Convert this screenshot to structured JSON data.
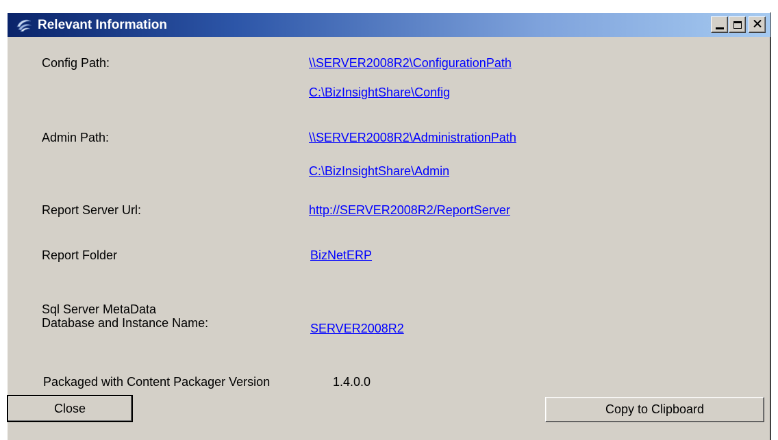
{
  "window": {
    "title": "Relevant Information",
    "icon": "app-swirl-icon",
    "controls": {
      "minimize": "minimize-icon",
      "maximize": "maximize-icon",
      "close": "close-icon"
    }
  },
  "fields": {
    "config_path": {
      "label": "Config Path:",
      "values": [
        "\\\\SERVER2008R2\\ConfigurationPath",
        "C:\\BizInsightShare\\Config"
      ]
    },
    "admin_path": {
      "label": "Admin Path:",
      "values": [
        "\\\\SERVER2008R2\\AdministrationPath",
        "C:\\BizInsightShare\\Admin"
      ]
    },
    "report_server_url": {
      "label": "Report Server Url:",
      "value": "http://SERVER2008R2/ReportServer"
    },
    "report_folder": {
      "label": "Report Folder",
      "value": "BizNetERP"
    },
    "sql_server": {
      "label_line1": "Sql Server MetaData",
      "label_line2": "Database and Instance Name:",
      "value": "SERVER2008R2"
    }
  },
  "version": {
    "label": "Packaged with Content Packager Version",
    "value": "1.4.0.0"
  },
  "buttons": {
    "close_label": "Close",
    "copy_label": "Copy to Clipboard"
  },
  "colors": {
    "title_gradient_start": "#0a246a",
    "title_gradient_end": "#a6caf0",
    "window_background": "#d4d0c8",
    "link": "#0000ff"
  }
}
